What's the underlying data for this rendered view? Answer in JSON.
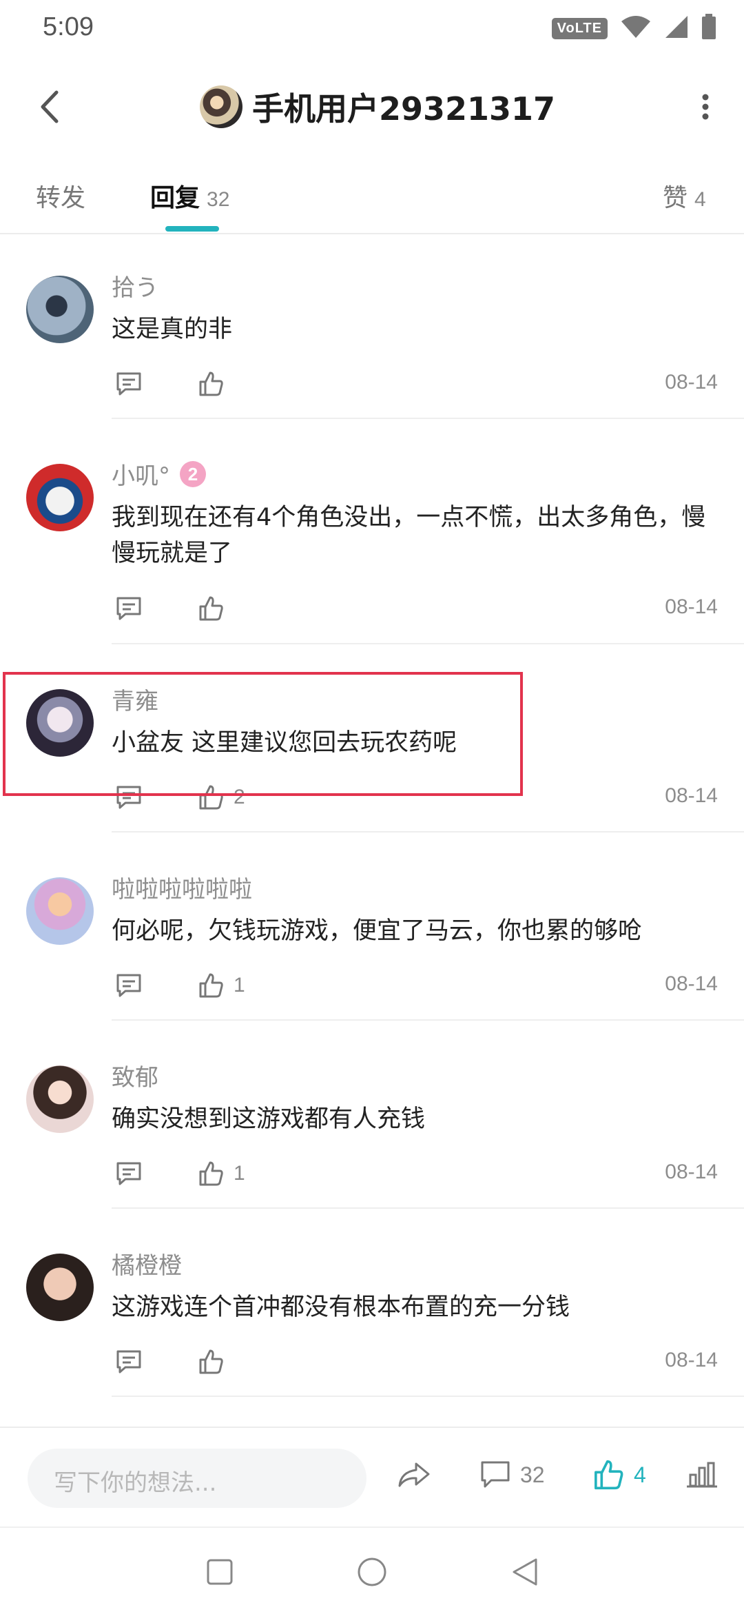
{
  "status_bar": {
    "time": "5:09",
    "volte": "VoLTE"
  },
  "header": {
    "title": "手机用户29321317"
  },
  "tabs": [
    {
      "label": "转发",
      "count": ""
    },
    {
      "label": "回复",
      "count": "32"
    },
    {
      "label": "赞",
      "count": "4"
    }
  ],
  "comments": [
    {
      "username": "拾う",
      "badge": "",
      "content": "这是真的非",
      "likes": "",
      "date": "08-14"
    },
    {
      "username": "小叽°",
      "badge": "2",
      "content": "我到现在还有4个角色没出，一点不慌，出太多角色，慢慢玩就是了",
      "likes": "",
      "date": "08-14"
    },
    {
      "username": "青雍",
      "badge": "",
      "content": "小盆友 这里建议您回去玩农药呢",
      "likes": "2",
      "date": "08-14"
    },
    {
      "username": "啦啦啦啦啦啦",
      "badge": "",
      "content": "何必呢，欠钱玩游戏，便宜了马云，你也累的够呛",
      "likes": "1",
      "date": "08-14"
    },
    {
      "username": "致郁",
      "badge": "",
      "content": "确实没想到这游戏都有人充钱",
      "likes": "1",
      "date": "08-14"
    },
    {
      "username": "橘橙橙",
      "badge": "",
      "content": "这游戏连个首冲都没有根本布置的充一分钱",
      "likes": "",
      "date": "08-14"
    }
  ],
  "bottom_bar": {
    "placeholder": "写下你的想法...",
    "comment_count": "32",
    "like_count": "4"
  },
  "colors": {
    "accent": "#22b3bd",
    "highlight": "#e2334d"
  }
}
